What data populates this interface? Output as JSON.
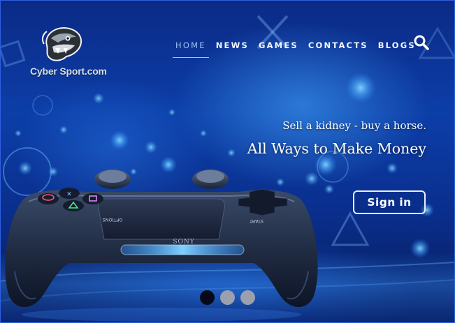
{
  "brand": {
    "name": "Cyber Sport.com",
    "logo_icon": "snake-head-icon"
  },
  "nav": {
    "items": [
      {
        "label": "HOME",
        "active": true
      },
      {
        "label": "NEWS",
        "active": false
      },
      {
        "label": "GAMES",
        "active": false
      },
      {
        "label": "CONTACTS",
        "active": false
      },
      {
        "label": "BLOGS",
        "active": false
      }
    ],
    "search_icon": "search-icon"
  },
  "hero": {
    "tagline": "Sell a kidney - buy a horse.",
    "headline": "All Ways to Make Money",
    "cta_label": "Sign in",
    "image": "gamepad-controller",
    "controller_brand": "SONY",
    "controller_labels": {
      "left": "OPTIONS",
      "right": "START"
    }
  },
  "carousel": {
    "slide_count": 3,
    "active_index": 0
  },
  "colors": {
    "background": "#0c3ea8",
    "accent": "#9fc0f2",
    "dot_active": "#060a18",
    "dot_inactive": "#9aa0ad",
    "lightbar": "#3fa9ff"
  }
}
